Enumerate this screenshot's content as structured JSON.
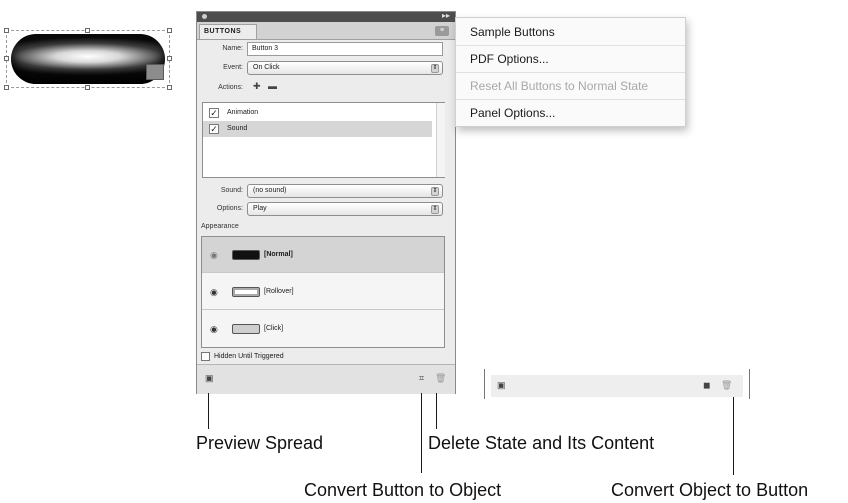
{
  "panel": {
    "title": "BUTTONS",
    "name_label": "Name:",
    "name_value": "Button 3",
    "event_label": "Event:",
    "event_value": "On Click",
    "actions_label": "Actions:",
    "actions": [
      "Animation",
      "Sound"
    ],
    "sound_label": "Sound:",
    "sound_value": "(no sound)",
    "options_label": "Options:",
    "options_value": "Play",
    "appearance_label": "Appearance",
    "states": [
      "[Normal]",
      "[Rollover]",
      "[Click]"
    ],
    "hidden_label": "Hidden Until Triggered"
  },
  "flyout_menu": {
    "items": [
      {
        "label": "Sample Buttons",
        "enabled": true
      },
      {
        "label": "PDF Options...",
        "enabled": true
      },
      {
        "label": "Reset All Buttons to Normal State",
        "enabled": false
      },
      {
        "label": "Panel Options...",
        "enabled": true
      }
    ]
  },
  "callouts": {
    "preview_spread": "Preview Spread",
    "delete_state": "Delete State and Its Content",
    "convert_to_object": "Convert Button to Object",
    "convert_to_button": "Convert Object to Button"
  },
  "colors": {
    "panel_bg": "#ececec",
    "selected_row": "#d6d6d6",
    "menu_disabled": "#a8a8a8"
  }
}
